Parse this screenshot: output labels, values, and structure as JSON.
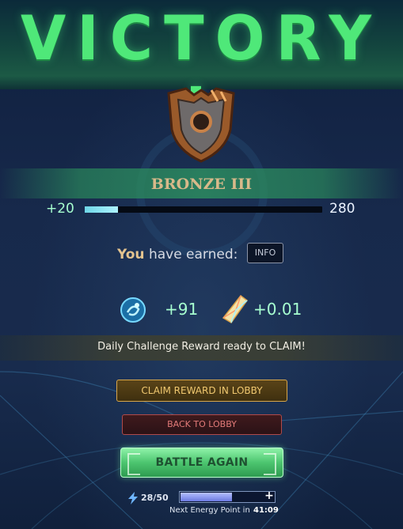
{
  "header": {
    "title": "VICTORY !"
  },
  "rank": {
    "name": "BRONZE III",
    "points_gained": "+20",
    "points_target": "280",
    "progress": 0.14
  },
  "earned": {
    "prefix": "You",
    "text": "have earned:",
    "info_label": "INFO"
  },
  "rewards": [
    {
      "icon": "blue-orb-icon",
      "value": "+91"
    },
    {
      "icon": "crystal-shard-icon",
      "value": "+0.01"
    }
  ],
  "daily": {
    "text": "Daily Challenge Reward ready to CLAIM!"
  },
  "buttons": {
    "claim": "CLAIM REWARD IN LOBBY",
    "back": "BACK TO LOBBY",
    "battle": "BATTLE AGAIN"
  },
  "energy": {
    "count": "28/50",
    "fraction": 0.56,
    "plus": "+",
    "next_label": "Next Energy Point in",
    "next_time": "41:09"
  },
  "colors": {
    "victory": "#4fe879",
    "accent_green": "#a7ffd0",
    "gold": "#d8b98a"
  }
}
